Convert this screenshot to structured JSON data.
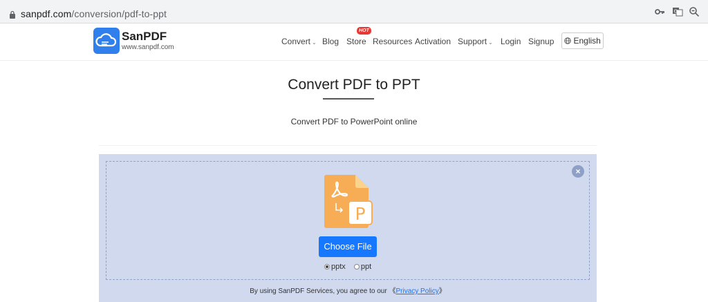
{
  "browser": {
    "url_host": "sanpdf.com",
    "url_path": "/conversion/pdf-to-ppt",
    "icons": [
      "lock-icon",
      "key-icon",
      "translate-icon",
      "zoom-icon"
    ]
  },
  "header": {
    "brand_name": "SanPDF",
    "brand_url": "www.sanpdf.com",
    "nav": {
      "convert": "Convert",
      "blog": "Blog",
      "store": "Store",
      "hot_badge": "HOT",
      "resources": "Resources",
      "activation": "Activation",
      "support": "Support",
      "login": "Login",
      "signup": "Signup"
    },
    "language": "English"
  },
  "main": {
    "title": "Convert PDF to PPT",
    "subtitle": "Convert PDF to PowerPoint online"
  },
  "upload": {
    "choose_file": "Choose File",
    "file_letter": "P",
    "formats": [
      {
        "label": "pptx",
        "selected": true
      },
      {
        "label": "ppt",
        "selected": false
      }
    ],
    "policy_prefix": "By using SanPDF Services, you agree to our",
    "policy_open": "《",
    "policy_link": "Privacy Policy",
    "policy_close": "》"
  },
  "colors": {
    "accent": "#1677ff",
    "panel": "#d0d9ee",
    "hot": "#e53935",
    "file_orange": "#f6ad55"
  }
}
